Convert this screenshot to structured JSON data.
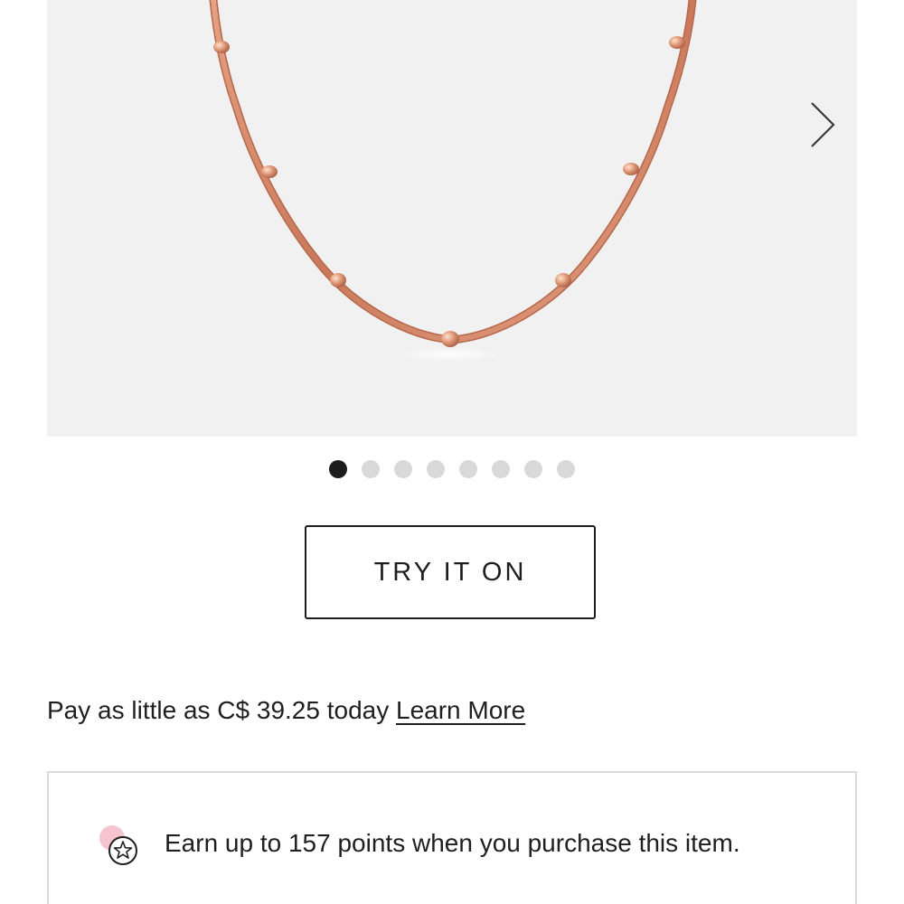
{
  "gallery": {
    "image_alt": "Rose gold beaded station necklace",
    "next_icon": "chevron-right-icon",
    "dot_count": 8,
    "active_dot": 0
  },
  "try_on": {
    "label": "TRY IT ON"
  },
  "payment": {
    "prefix": "Pay as little as C$ 39.25 today",
    "link_label": "Learn More"
  },
  "rewards": {
    "icon": "star-badge-icon",
    "text": "Earn up to 157 points when you purchase this item."
  },
  "colors": {
    "gallery_bg": "#f2f1f1",
    "chain": "#d9896b",
    "dot_active": "#1d1d1d",
    "dot_inactive": "#d9d9d9",
    "icon_pink": "#f5c4cf"
  }
}
